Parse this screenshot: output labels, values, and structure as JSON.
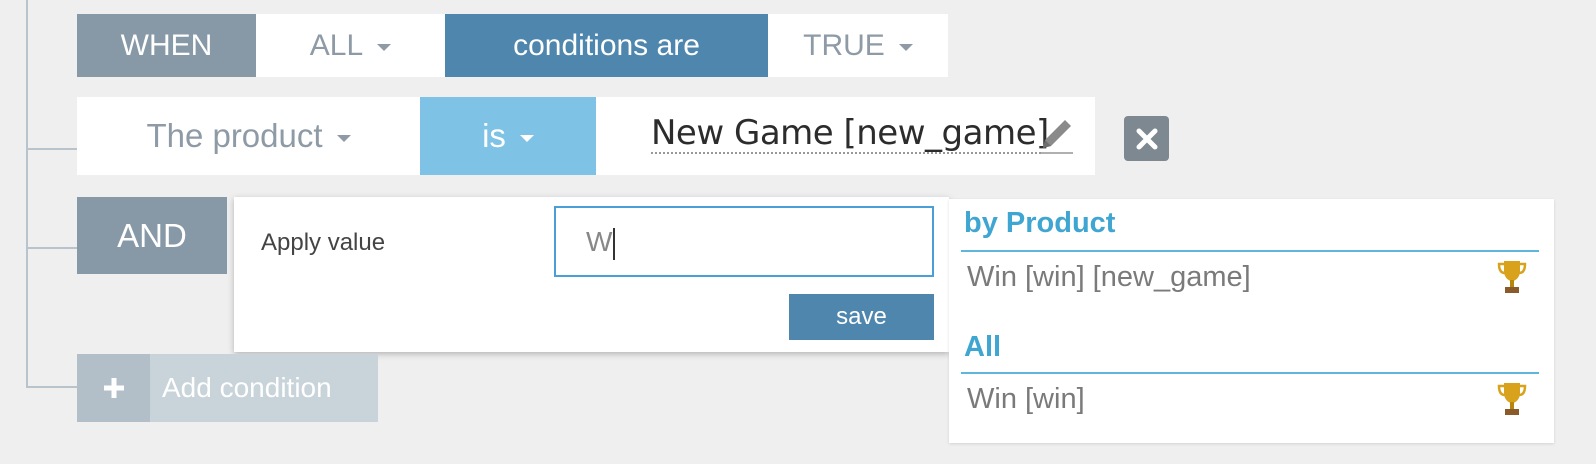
{
  "rule": {
    "when_label": "WHEN",
    "aggregator": "ALL",
    "conditions_text": "conditions are",
    "value": "TRUE"
  },
  "condition": {
    "attribute": "The product",
    "operator": "is",
    "value": "New Game [new_game]"
  },
  "and_label": "AND",
  "apply": {
    "label": "Apply value",
    "input_value": "W",
    "save_label": "save"
  },
  "autocomplete": {
    "groups": [
      {
        "title": "by Product",
        "items": [
          {
            "label": "Win [win] [new_game]",
            "icon": "trophy-icon"
          }
        ]
      },
      {
        "title": "All",
        "items": [
          {
            "label": "Win [win]",
            "icon": "trophy-icon"
          }
        ]
      }
    ]
  },
  "add_condition": {
    "label": "Add condition",
    "icon": "plus-icon"
  },
  "colors": {
    "header_gray": "#8798a7",
    "primary_blue": "#4f86ad",
    "light_blue": "#7ec2e5",
    "group_title": "#3fa6d2",
    "trophy_gold": "#d9a21c"
  }
}
